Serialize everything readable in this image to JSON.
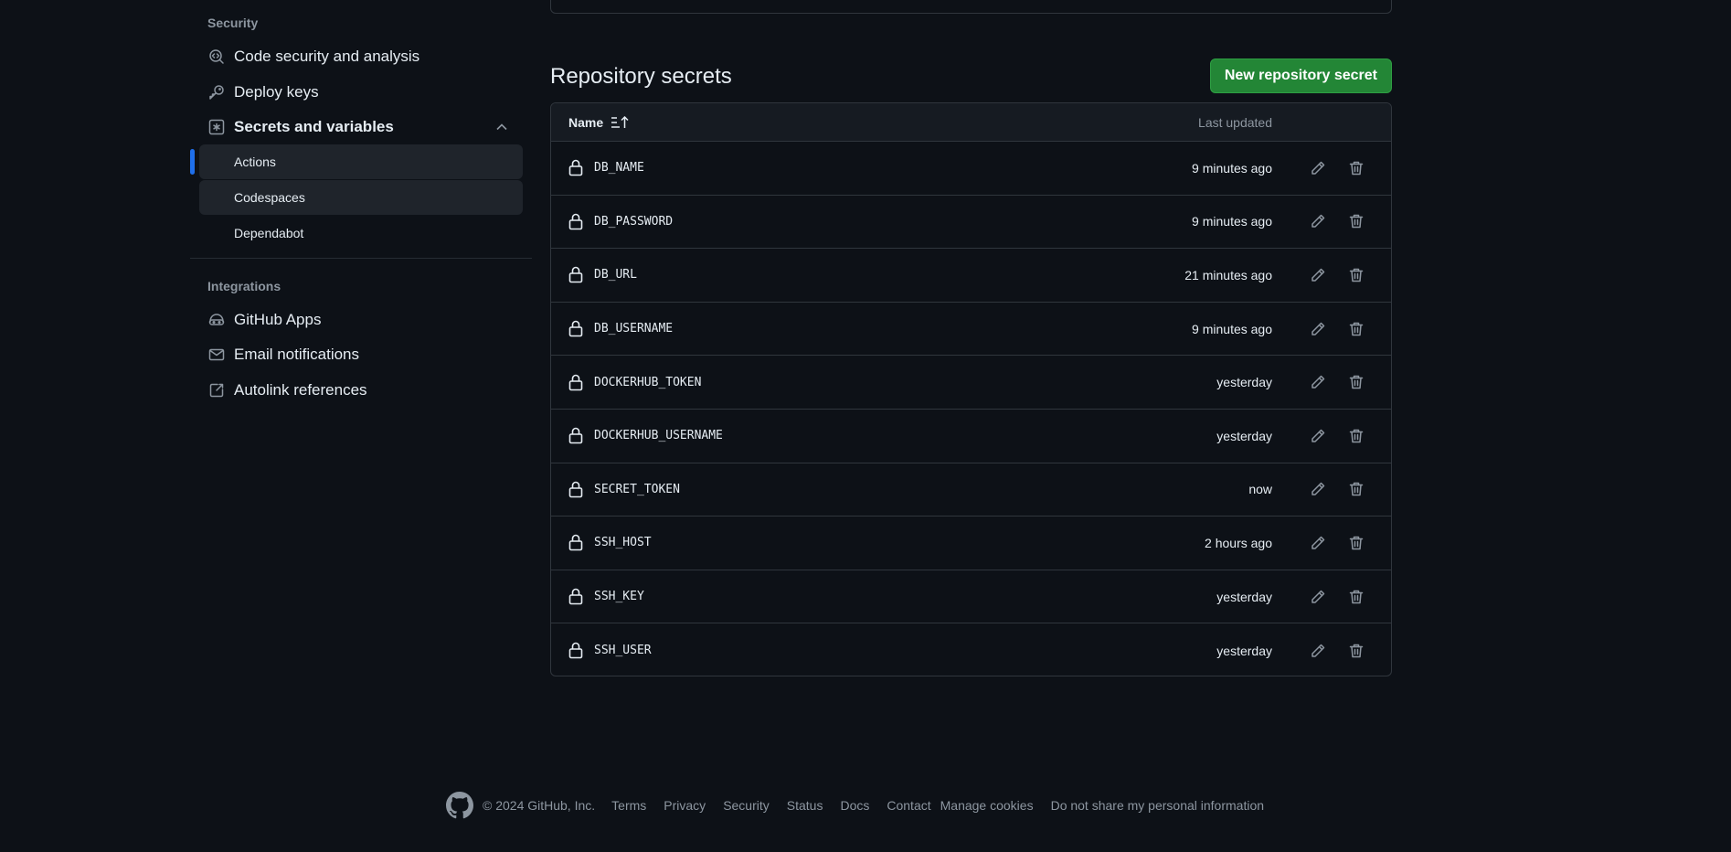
{
  "sidebar": {
    "security_heading": "Security",
    "security_items": [
      {
        "label": "Code security and analysis",
        "icon": "codescan-icon"
      },
      {
        "label": "Deploy keys",
        "icon": "key-icon"
      },
      {
        "label": "Secrets and variables",
        "icon": "asterisk-icon"
      }
    ],
    "secrets_sub": [
      {
        "label": "Actions",
        "active": true
      },
      {
        "label": "Codespaces",
        "active": false
      },
      {
        "label": "Dependabot",
        "active": false
      }
    ],
    "integrations_heading": "Integrations",
    "integration_items": [
      {
        "label": "GitHub Apps",
        "icon": "apps-icon"
      },
      {
        "label": "Email notifications",
        "icon": "mail-icon"
      },
      {
        "label": "Autolink references",
        "icon": "cross-reference-icon"
      }
    ]
  },
  "main": {
    "title": "Repository secrets",
    "new_button": "New repository secret",
    "table": {
      "col_name": "Name",
      "col_updated": "Last updated",
      "rows": [
        {
          "name": "DB_NAME",
          "updated": "9 minutes ago"
        },
        {
          "name": "DB_PASSWORD",
          "updated": "9 minutes ago"
        },
        {
          "name": "DB_URL",
          "updated": "21 minutes ago"
        },
        {
          "name": "DB_USERNAME",
          "updated": "9 minutes ago"
        },
        {
          "name": "DOCKERHUB_TOKEN",
          "updated": "yesterday"
        },
        {
          "name": "DOCKERHUB_USERNAME",
          "updated": "yesterday"
        },
        {
          "name": "SECRET_TOKEN",
          "updated": "now"
        },
        {
          "name": "SSH_HOST",
          "updated": "2 hours ago"
        },
        {
          "name": "SSH_KEY",
          "updated": "yesterday"
        },
        {
          "name": "SSH_USER",
          "updated": "yesterday"
        }
      ]
    }
  },
  "footer": {
    "copyright": "© 2024 GitHub, Inc.",
    "links": [
      "Terms",
      "Privacy",
      "Security",
      "Status",
      "Docs",
      "Contact",
      "Manage cookies",
      "Do not share my personal information"
    ]
  },
  "colors": {
    "background": "#0d1117",
    "primary_button": "#238636",
    "active_indicator": "#1f6feb",
    "border": "#30363d"
  }
}
